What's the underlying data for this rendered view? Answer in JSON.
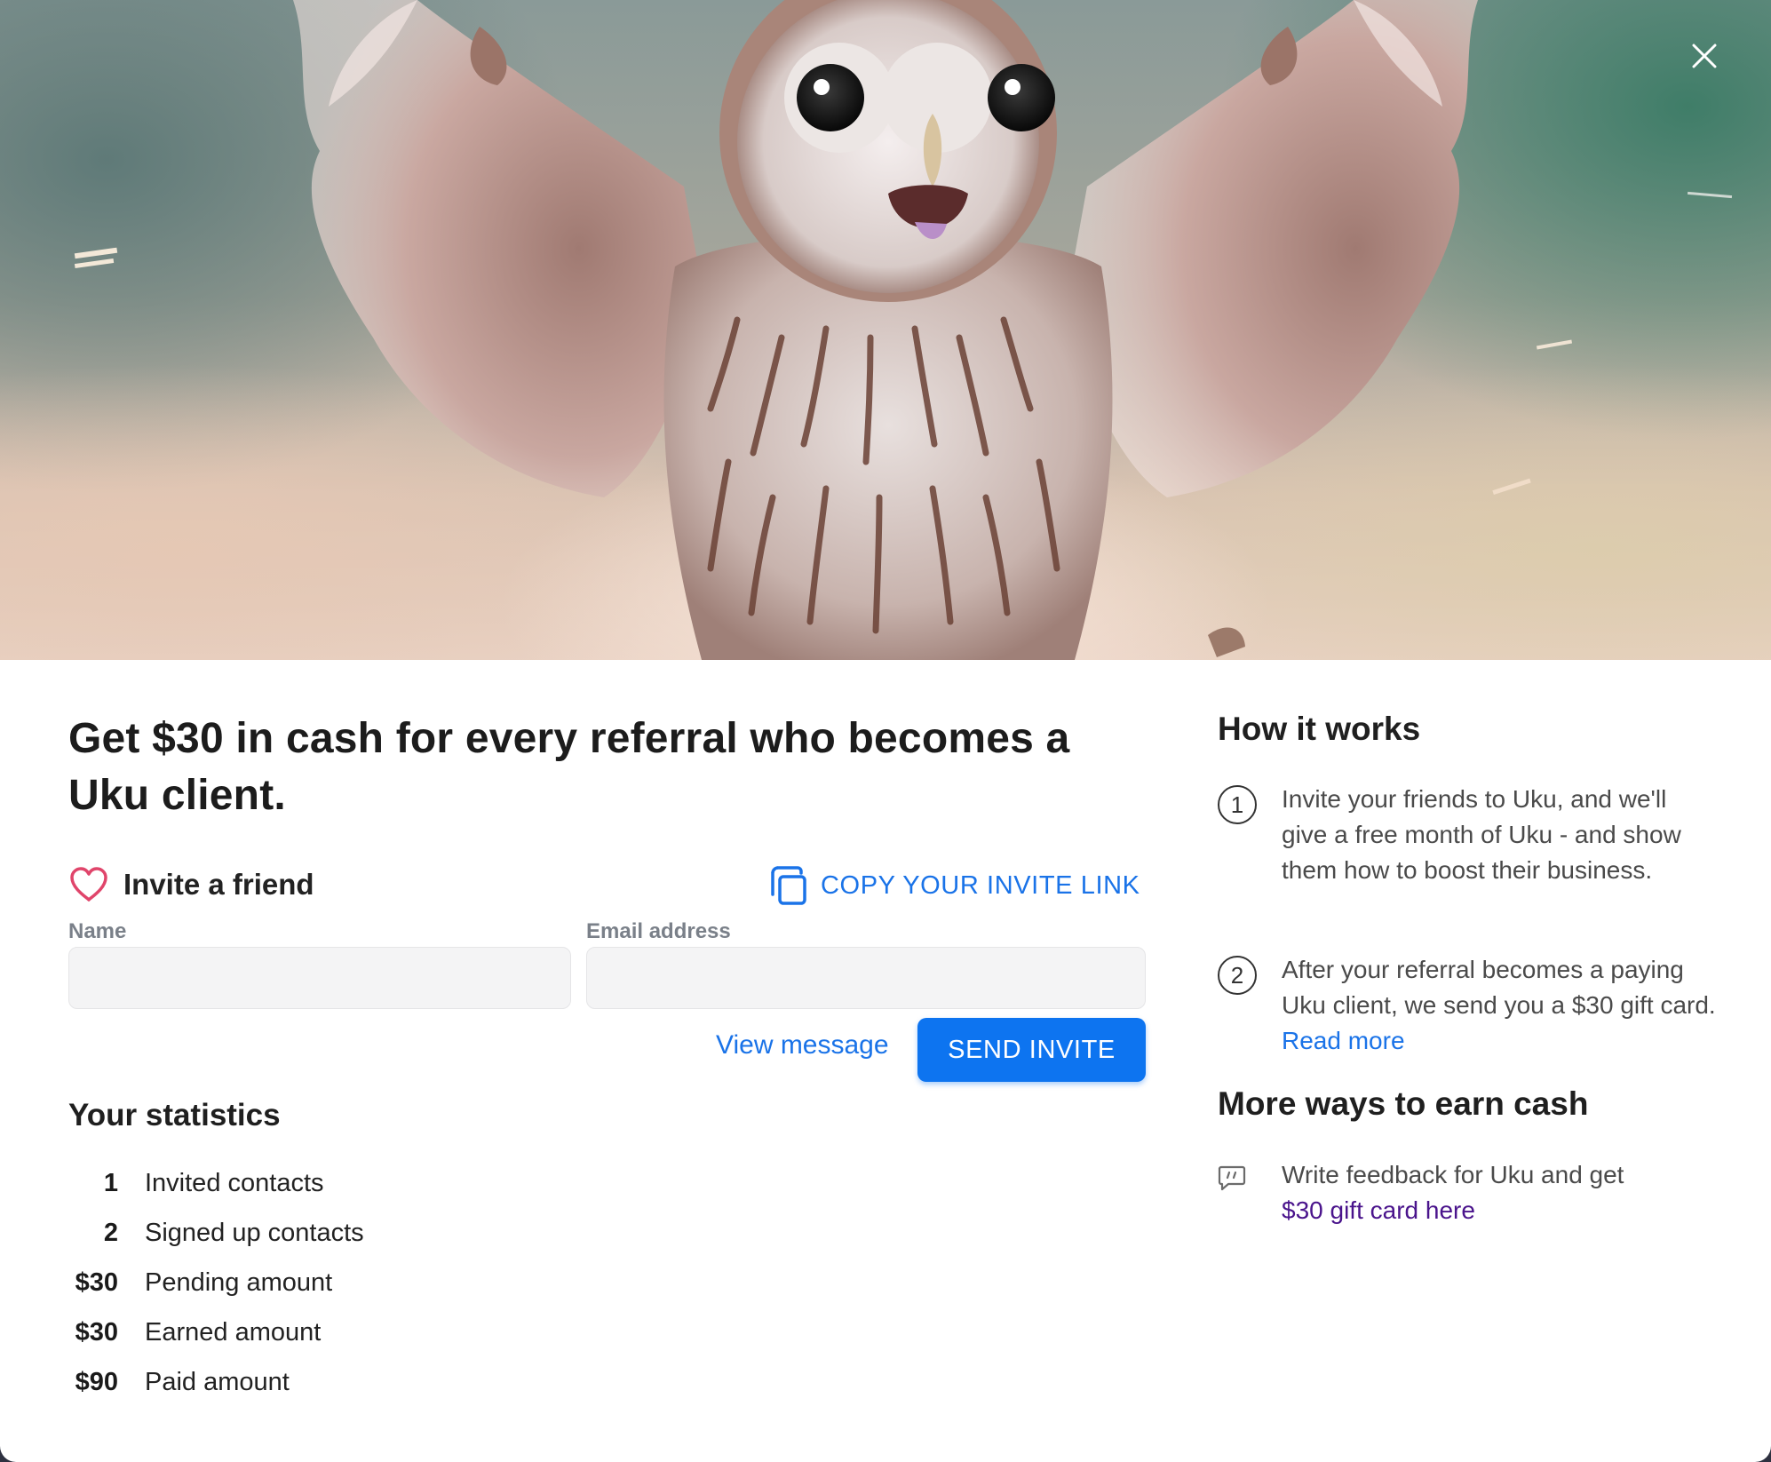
{
  "dialog": {
    "close_label": "close",
    "hero_image": "owl-illustration",
    "headline": "Get $30 in cash for every referral who becomes a Uku client."
  },
  "invite": {
    "title": "Invite a friend",
    "copy_link_label": "COPY YOUR INVITE LINK",
    "name_label": "Name",
    "name_value": "",
    "name_placeholder": "",
    "email_label": "Email address",
    "email_value": "",
    "email_placeholder": "",
    "view_message_label": "View message",
    "send_label": "SEND INVITE"
  },
  "statistics": {
    "title": "Your statistics",
    "rows": [
      {
        "value": "1",
        "label": "Invited contacts"
      },
      {
        "value": "2",
        "label": "Signed up contacts"
      },
      {
        "value": "$30",
        "label": "Pending amount"
      },
      {
        "value": "$30",
        "label": "Earned amount"
      },
      {
        "value": "$90",
        "label": "Paid amount"
      }
    ]
  },
  "how_it_works": {
    "title": "How it works",
    "steps": [
      {
        "number": "1",
        "text": "Invite your friends to Uku, and we'll give a free month of Uku - and show them how to boost their business."
      },
      {
        "number": "2",
        "text": "After your referral becomes a paying Uku client, we send you a $30 gift card. ",
        "link": "Read more"
      }
    ]
  },
  "more_ways": {
    "title": "More ways to earn cash",
    "text": "Write feedback for Uku and get ",
    "link": "$30 gift card here"
  },
  "icons": {
    "close": "close-icon",
    "heart": "heart-icon",
    "copy": "copy-icon",
    "feedback": "chat-quote-icon"
  },
  "colors": {
    "accent": "#0d74f0",
    "link": "#1a73e8",
    "visited_link": "#4a148c",
    "heart": "#e0456b",
    "input_bg": "#f4f4f5"
  }
}
